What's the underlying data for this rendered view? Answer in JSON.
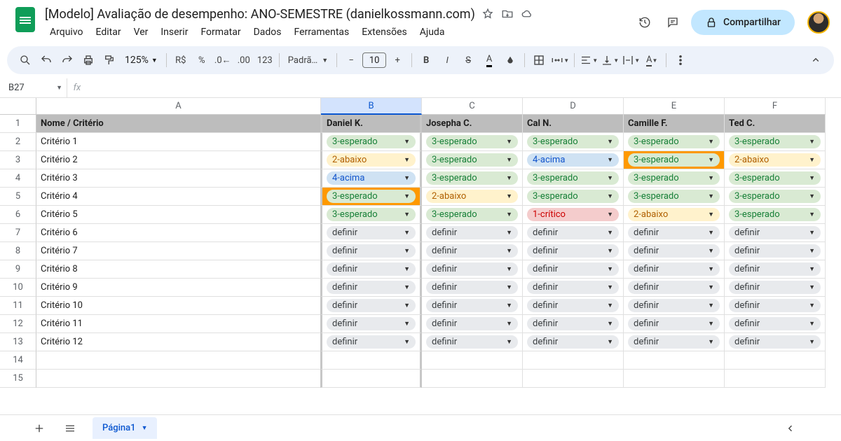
{
  "title": "[Modelo] Avaliação de desempenho: ANO-SEMESTRE (danielkossmann.com)",
  "menus": [
    "Arquivo",
    "Editar",
    "Ver",
    "Inserir",
    "Formatar",
    "Dados",
    "Ferramentas",
    "Extensões",
    "Ajuda"
  ],
  "share": "Compartilhar",
  "zoom": "125%",
  "currency": "R$",
  "fontname": "Padrã…",
  "fontsize": "10",
  "namebox": "B27",
  "tab": "Página1",
  "chip_labels": {
    "esp": "3-esperado",
    "abx": "2-abaixo",
    "aci": "4-acima",
    "cri": "1-crítico",
    "def": "definir"
  },
  "cols": [
    "A",
    "B",
    "C",
    "D",
    "E",
    "F"
  ],
  "headers": [
    "Nome / Critério",
    "Daniel K.",
    "Josepha C.",
    "Cal N.",
    "Camille F.",
    "Ted C."
  ],
  "rows": [
    {
      "n": "1"
    },
    {
      "n": "2",
      "label": "Critério 1",
      "vals": [
        "esp",
        "esp",
        "esp",
        "esp",
        "esp"
      ],
      "hl": []
    },
    {
      "n": "3",
      "label": "Critério 2",
      "vals": [
        "abx",
        "esp",
        "aci",
        "esp",
        "abx"
      ],
      "hl": [
        3
      ]
    },
    {
      "n": "4",
      "label": "Critério 3",
      "vals": [
        "aci",
        "esp",
        "esp",
        "esp",
        "esp"
      ],
      "hl": []
    },
    {
      "n": "5",
      "label": "Critério 4",
      "vals": [
        "esp",
        "abx",
        "esp",
        "esp",
        "esp"
      ],
      "hl": [
        0
      ]
    },
    {
      "n": "6",
      "label": "Critério 5",
      "vals": [
        "esp",
        "esp",
        "cri",
        "abx",
        "esp"
      ],
      "hl": []
    },
    {
      "n": "7",
      "label": "Critério 6",
      "vals": [
        "def",
        "def",
        "def",
        "def",
        "def"
      ],
      "hl": []
    },
    {
      "n": "8",
      "label": "Critério 7",
      "vals": [
        "def",
        "def",
        "def",
        "def",
        "def"
      ],
      "hl": []
    },
    {
      "n": "9",
      "label": "Critério 8",
      "vals": [
        "def",
        "def",
        "def",
        "def",
        "def"
      ],
      "hl": []
    },
    {
      "n": "10",
      "label": "Critério 9",
      "vals": [
        "def",
        "def",
        "def",
        "def",
        "def"
      ],
      "hl": []
    },
    {
      "n": "11",
      "label": "Critério 10",
      "vals": [
        "def",
        "def",
        "def",
        "def",
        "def"
      ],
      "hl": []
    },
    {
      "n": "12",
      "label": "Critério 11",
      "vals": [
        "def",
        "def",
        "def",
        "def",
        "def"
      ],
      "hl": []
    },
    {
      "n": "13",
      "label": "Critério 12",
      "vals": [
        "def",
        "def",
        "def",
        "def",
        "def"
      ],
      "hl": []
    },
    {
      "n": "14",
      "label": "",
      "vals": null
    },
    {
      "n": "15",
      "label": "",
      "vals": null
    }
  ]
}
